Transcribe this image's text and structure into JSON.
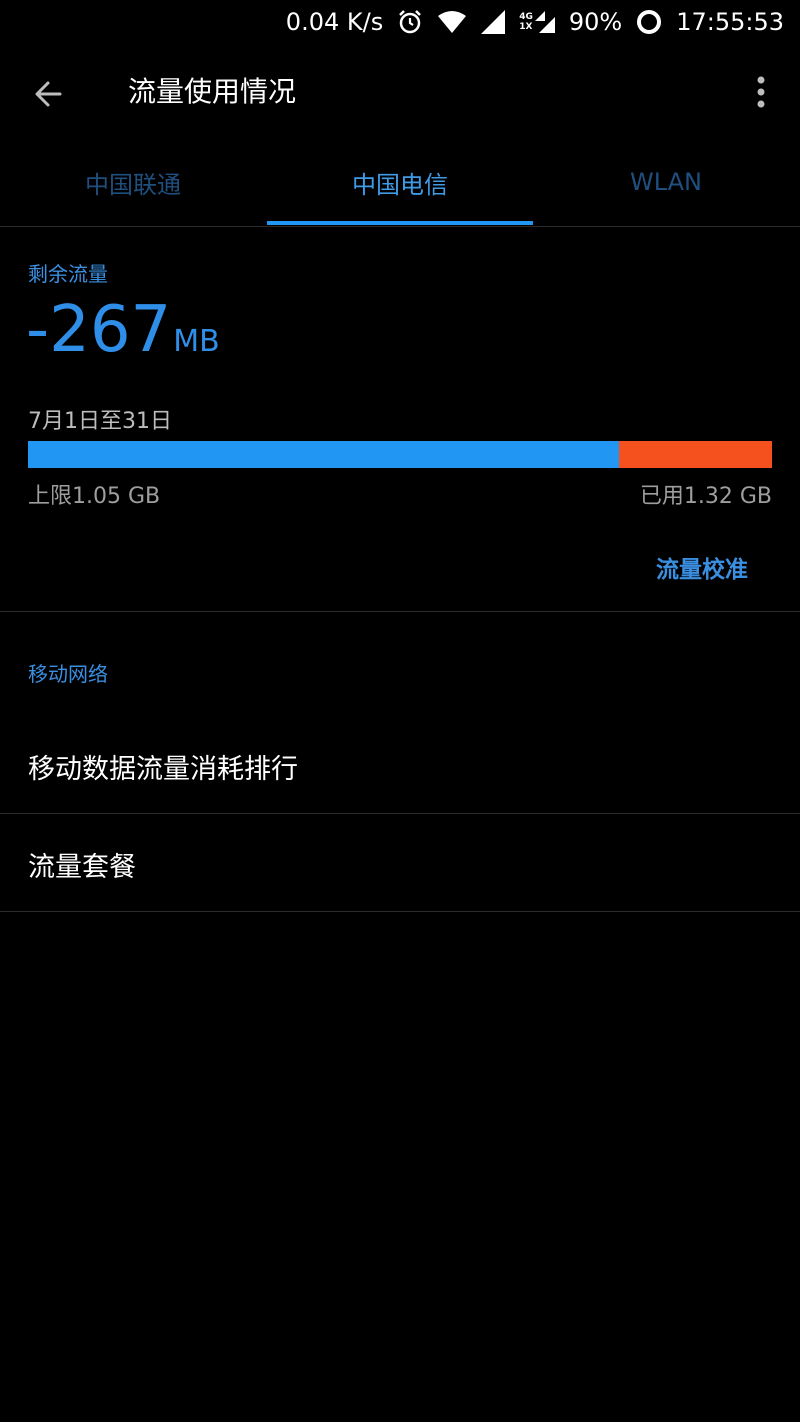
{
  "status_bar": {
    "net_speed": "0.04 K/s",
    "net_type_top": "4G",
    "net_type_bottom": "1X",
    "battery": "90%",
    "time": "17:55:53",
    "icons": [
      "alarm-icon",
      "wifi-icon",
      "signal-icon",
      "signal-icon",
      "battery-ring-icon"
    ]
  },
  "app_bar": {
    "title": "流量使用情况",
    "back_icon": "arrow-left-icon",
    "menu_icon": "more-vert-icon"
  },
  "tabs": [
    {
      "label": "中国联通",
      "selected": false
    },
    {
      "label": "中国电信",
      "selected": true
    },
    {
      "label": "WLAN",
      "selected": false
    }
  ],
  "usage": {
    "remaining_label": "剩余流量",
    "remaining_value": "-267",
    "remaining_unit": "MB",
    "period": "7月1日至31日",
    "limit_text": "上限1.05 GB",
    "used_text": "已用1.32 GB",
    "limit_fraction_of_usage": 0.795,
    "calibrate_label": "流量校准"
  },
  "section": {
    "header": "移动网络",
    "items": [
      "移动数据流量消耗排行",
      "流量套餐"
    ]
  },
  "colors": {
    "accent": "#2196f3",
    "over_usage": "#f4511e",
    "background": "#000000"
  }
}
